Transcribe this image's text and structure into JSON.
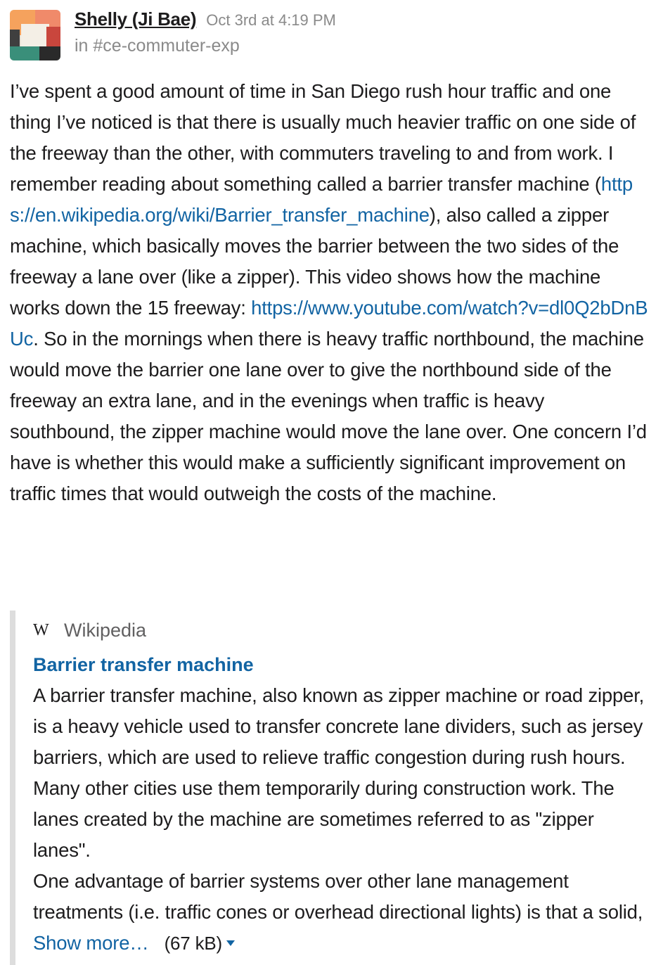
{
  "message": {
    "author": "Shelly (Ji Bae)",
    "timestamp": "Oct 3rd at 4:19 PM",
    "channel_prefix": "in ",
    "channel": "#ce-commuter-exp",
    "text_part1": "I’ve spent a good amount of time in San Diego rush hour traffic and one thing I’ve noticed is that there is usually much heavier traffic on one side of the freeway than the other, with commuters traveling to and from work. I remember reading about something called a barrier transfer machine (",
    "link1": "https://en.wikipedia.org/wiki/Barrier_transfer_machine",
    "text_part2": "), also called a zipper machine, which basically moves the barrier between the two sides of the freeway a lane over (like a zipper). This video shows how the machine works down the 15 freeway: ",
    "link2": "https://www.youtube.com/watch?v=dl0Q2bDnBUc",
    "text_part3": ". So in the mornings when there is heavy traffic northbound, the machine would move the barrier one lane over to give the northbound side of the freeway an extra lane, and in the evenings when traffic is heavy southbound, the zipper machine would move the lane over. One concern I’d have is whether this would make a sufficiently significant improvement on traffic times that would outweigh the costs of the machine."
  },
  "attachment": {
    "source_icon": "W",
    "source_name": "Wikipedia",
    "title": "Barrier transfer machine",
    "paragraph1": "A barrier transfer machine, also known as zipper machine or road zipper, is a heavy vehicle used to transfer concrete lane dividers, such as jersey barriers, which are used to relieve traffic congestion during rush hours. Many other cities use them temporarily during construction work. The lanes created by the machine are sometimes referred to as \"zipper lanes\".",
    "paragraph2": "One advantage of barrier systems over other lane management treatments (i.e. traffic cones or overhead directional lights) is that a solid, ",
    "show_more": "Show more…",
    "file_size": "(67 kB)"
  },
  "avatar_colors": [
    "#f5a25d",
    "#e8e2d6",
    "#c9463d",
    "#3a8f7a",
    "#2a2a2a"
  ],
  "link_color": "#1264a3"
}
